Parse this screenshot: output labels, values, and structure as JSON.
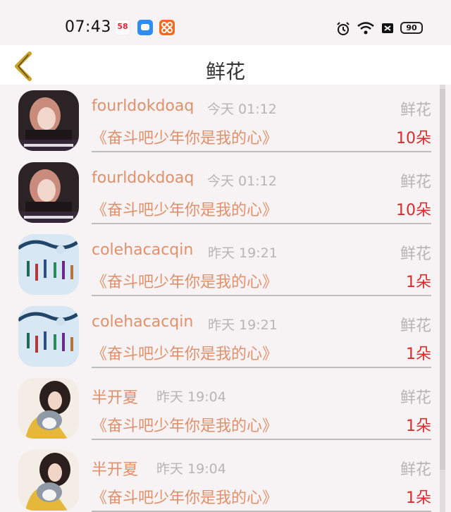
{
  "status_bar": {
    "time": "07:43",
    "app_icons": [
      "58-icon",
      "message-icon",
      "grid-app-icon"
    ],
    "icon_58_text": "58",
    "battery": "90"
  },
  "header": {
    "title": "鲜花",
    "back_icon": "chevron-left-icon"
  },
  "colors": {
    "accent": "#e0906a",
    "count": "#d52c2c",
    "muted": "#b5b5b5",
    "back_chevron": "#c8a12a"
  },
  "items": [
    {
      "user": "fourldokdoaq",
      "time": "今天 01:12",
      "gift": "鲜花",
      "song": "《奋斗吧少年你是我的心》",
      "count": "10朵",
      "avatar": "girl-avatar"
    },
    {
      "user": "fourldokdoaq",
      "time": "今天 01:12",
      "gift": "鲜花",
      "song": "《奋斗吧少年你是我的心》",
      "count": "10朵",
      "avatar": "girl-avatar"
    },
    {
      "user": "colehacacqin",
      "time": "昨天 19:21",
      "gift": "鲜花",
      "song": "《奋斗吧少年你是我的心》",
      "count": "1朵",
      "avatar": "windchime-avatar"
    },
    {
      "user": "colehacacqin",
      "time": "昨天 19:21",
      "gift": "鲜花",
      "song": "《奋斗吧少年你是我的心》",
      "count": "1朵",
      "avatar": "windchime-avatar"
    },
    {
      "user": "半开夏",
      "time": "昨天 19:04",
      "gift": "鲜花",
      "song": "《奋斗吧少年你是我的心》",
      "count": "1朵",
      "avatar": "cat-girl-avatar"
    },
    {
      "user": "半开夏",
      "time": "昨天 19:04",
      "gift": "鲜花",
      "song": "《奋斗吧少年你是我的心》",
      "count": "1朵",
      "avatar": "cat-girl-avatar"
    }
  ]
}
